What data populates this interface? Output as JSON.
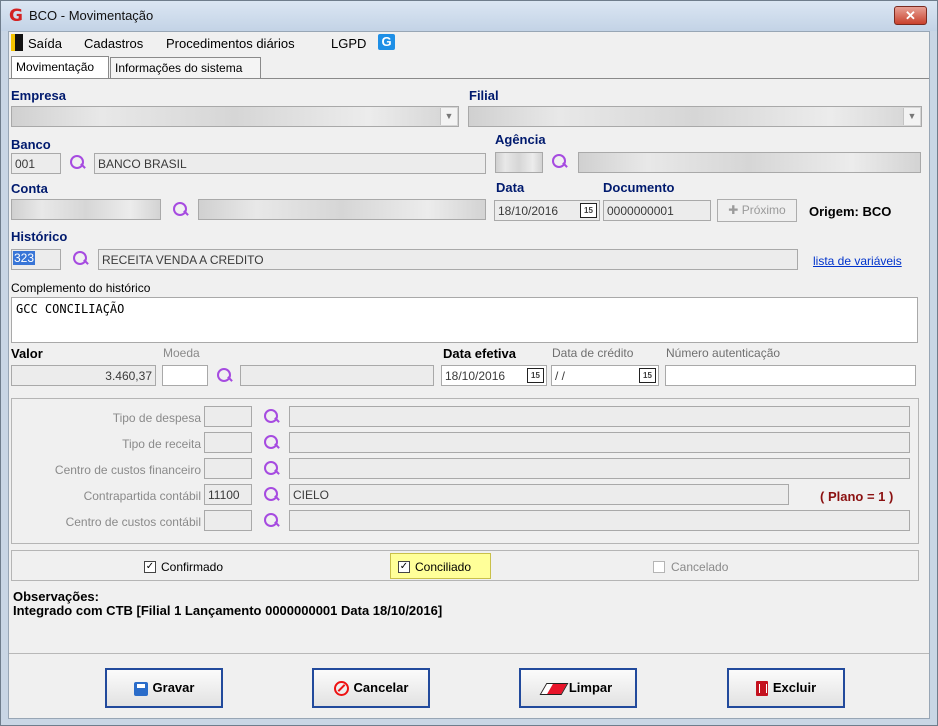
{
  "window": {
    "title": "BCO - Movimentação",
    "logo_glyph": "G",
    "close_glyph": "✕"
  },
  "menu": {
    "items": [
      "Saída",
      "Cadastros",
      "Procedimentos diários",
      "LGPD"
    ],
    "lgpd_icon_glyph": "G"
  },
  "tabs": [
    "Movimentação",
    "Informações do sistema"
  ],
  "form": {
    "empresa_label": "Empresa",
    "filial_label": "Filial",
    "banco_label": "Banco",
    "banco_code": "001",
    "banco_name": "BANCO BRASIL",
    "agencia_label": "Agência",
    "conta_label": "Conta",
    "data_label": "Data",
    "data_value": "18/10/2016",
    "documento_label": "Documento",
    "documento_value": "0000000001",
    "proximo_label": "Próximo",
    "origem_text": "Origem: BCO",
    "historico_label": "Histórico",
    "historico_code": "323",
    "historico_name": "RECEITA VENDA A CREDITO",
    "lista_variaveis_link": "lista de variáveis",
    "complemento_label": "Complemento do histórico",
    "complemento_value": "GCC CONCILIAÇÃO",
    "valor_label": "Valor",
    "valor_value": "3.460,37",
    "moeda_label": "Moeda",
    "data_efetiva_label": "Data efetiva",
    "data_efetiva_value": "18/10/2016",
    "data_credito_label": "Data de crédito",
    "data_credito_value": " / /",
    "numero_autenticacao_label": "Número autenticação",
    "calendar_glyph": "15"
  },
  "group": {
    "tipo_despesa_label": "Tipo de despesa",
    "tipo_receita_label": "Tipo de receita",
    "centro_custos_fin_label": "Centro de custos financeiro",
    "contrapartida_label": "Contrapartida contábil",
    "contrapartida_code": "11100",
    "contrapartida_name": "CIELO",
    "plano_text": "( Plano = 1 )",
    "centro_custos_cont_label": "Centro de custos contábil"
  },
  "checks": {
    "confirmado_label": "Confirmado",
    "conciliado_label": "Conciliado",
    "cancelado_label": "Cancelado",
    "check_glyph": "✓",
    "highlight_color": "#ffff99"
  },
  "obs": {
    "title": "Observações:",
    "text": "Integrado com CTB [Filial 1 Lançamento 0000000001 Data 18/10/2016]"
  },
  "buttons": {
    "gravar": "Gravar",
    "cancelar": "Cancelar",
    "limpar": "Limpar",
    "excluir": "Excluir"
  }
}
